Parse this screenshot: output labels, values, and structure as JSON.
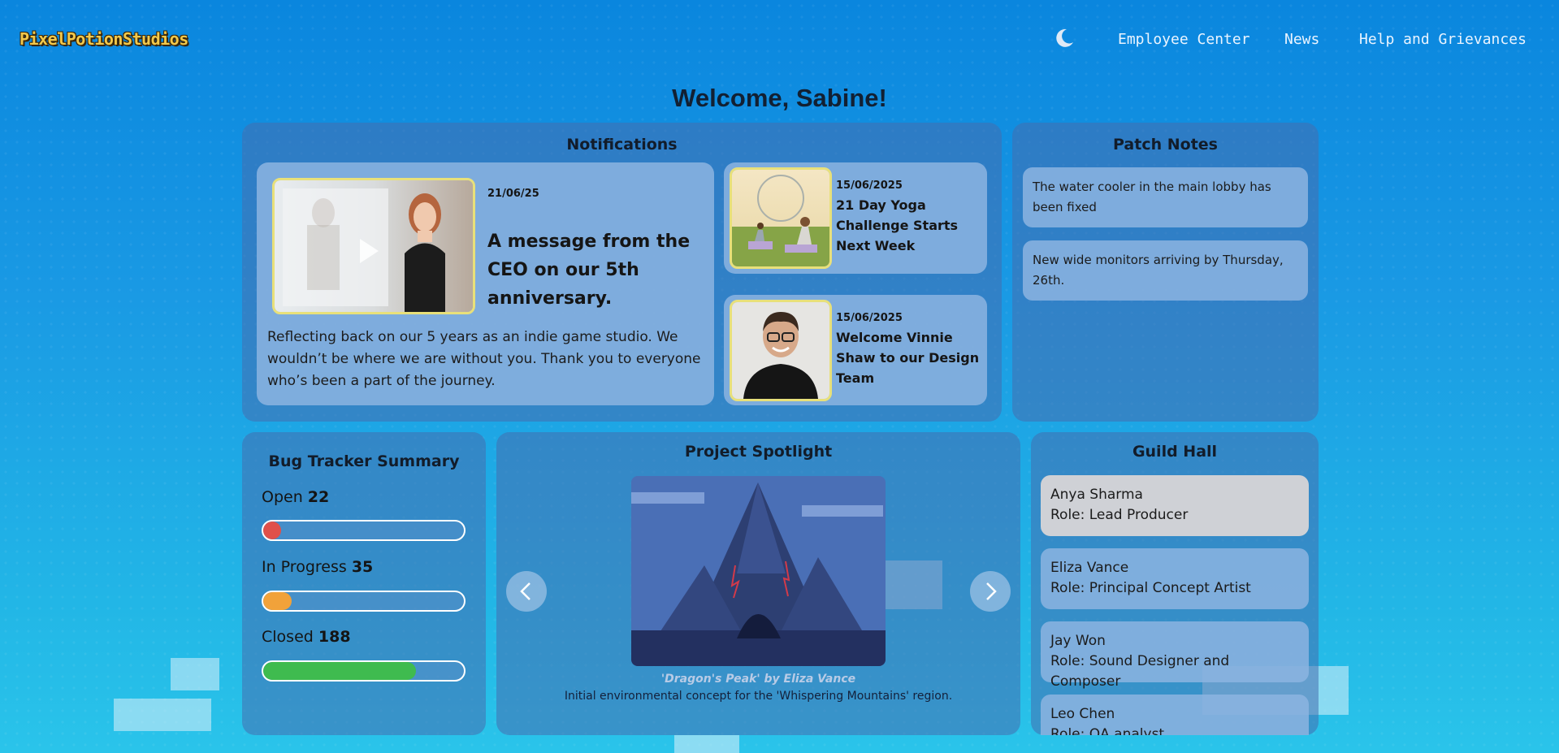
{
  "brand": {
    "logo": "PixelPotionStudios"
  },
  "nav": {
    "theme_icon": "moon-icon",
    "links": [
      "Employee Center",
      "News",
      "Help and Grievances"
    ]
  },
  "welcome": "Welcome, Sabine!",
  "notifications": {
    "title": "Notifications",
    "featured": {
      "date": "21/06/25",
      "title": "A message from the CEO on our 5th anniversary.",
      "body": "Reflecting back on our 5 years as an indie game studio. We wouldn’t be where we are without you. Thank you to everyone who’s been a part of the journey."
    },
    "items": [
      {
        "date": "15/06/2025",
        "title": "21 Day Yoga Challenge Starts Next Week"
      },
      {
        "date": "15/06/2025",
        "title": "Welcome Vinnie Shaw to our Design Team"
      }
    ]
  },
  "patch_notes": {
    "title": "Patch Notes",
    "items": [
      "The water cooler in the main lobby has been fixed",
      "New wide monitors arriving by Thursday, 26th."
    ]
  },
  "bug_tracker": {
    "title": "Bug Tracker Summary",
    "rows": [
      {
        "label": "Open",
        "count": "22",
        "fraction": 0.09,
        "color": "#e0504a"
      },
      {
        "label": "In Progress",
        "count": "35",
        "fraction": 0.14,
        "color": "#f1a23a"
      },
      {
        "label": "Closed",
        "count": "188",
        "fraction": 0.76,
        "color": "#3fbb4f"
      }
    ]
  },
  "spotlight": {
    "title": "Project Spotlight",
    "caption_title": "'Dragon's Peak' by Eliza Vance",
    "caption_text": "Initial environmental concept for the 'Whispering Mountains' region."
  },
  "guild_hall": {
    "title": "Guild Hall",
    "members": [
      {
        "name": "Anya Sharma",
        "role": "Role: Lead Producer"
      },
      {
        "name": "Eliza Vance",
        "role": "Role: Principal Concept Artist"
      },
      {
        "name": "Jay Won",
        "role": "Role: Sound Designer and Composer"
      },
      {
        "name": "Leo Chen",
        "role": "Role: QA analyst"
      }
    ]
  }
}
